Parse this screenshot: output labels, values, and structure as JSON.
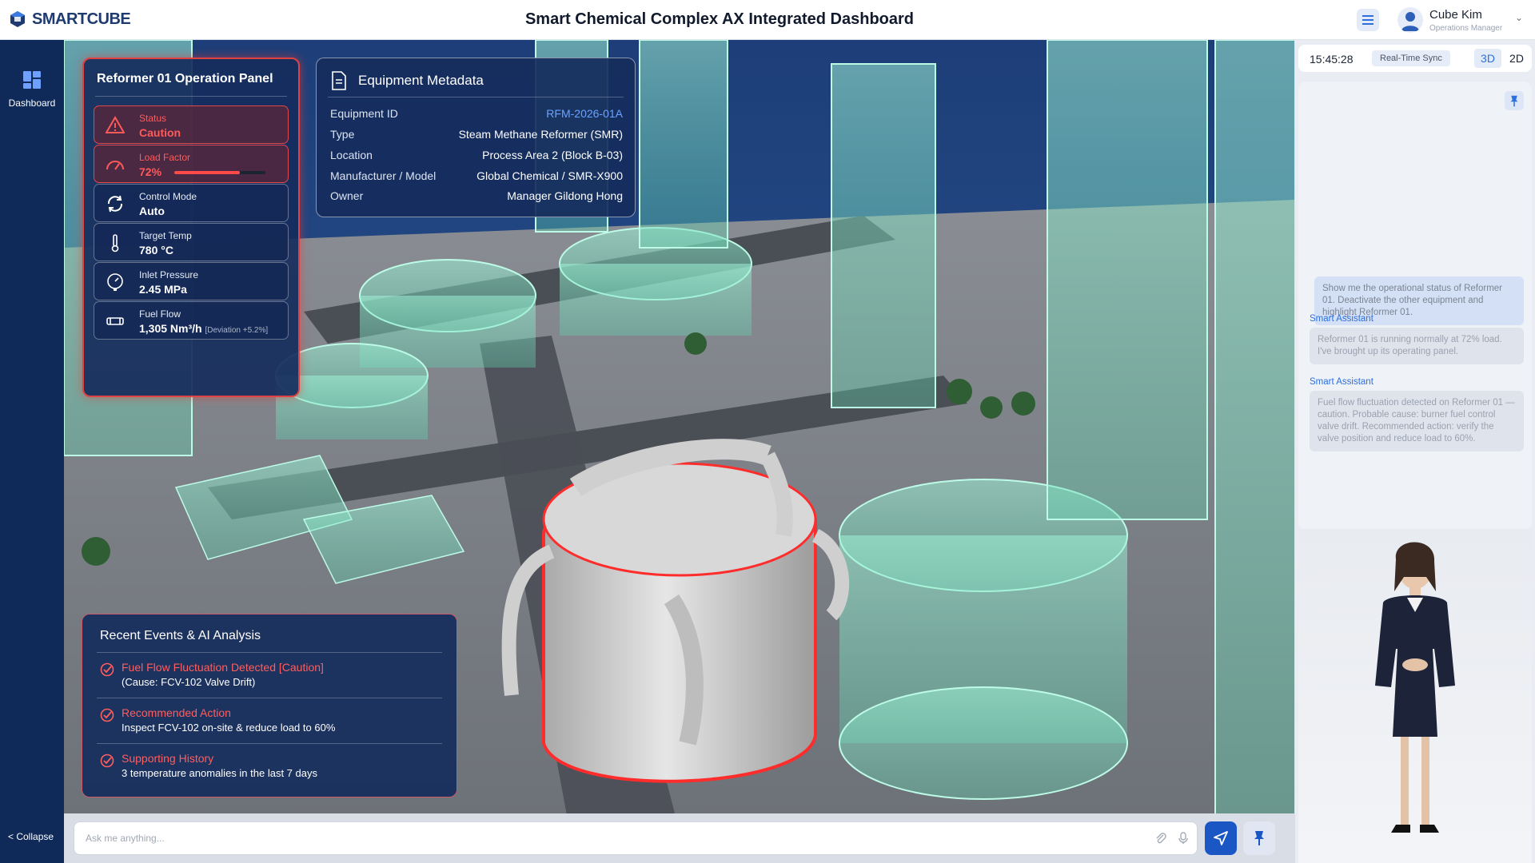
{
  "app": {
    "logo_text": "SMARTCUBE",
    "title": "Smart Chemical Complex AX Integrated Dashboard",
    "user_name": "Cube Kim",
    "user_role": "Operations Manager"
  },
  "nav": {
    "items": [
      {
        "label": "Dashboard",
        "icon": "dashboard-grid-icon"
      }
    ],
    "collapse_label": "< Collapse"
  },
  "operation_panel": {
    "title": "Reformer 01 Operation Panel",
    "cards": [
      {
        "label": "Status",
        "value": "Caution",
        "icon": "warning-icon",
        "alert": true
      },
      {
        "label": "Load Factor",
        "value": "72%",
        "icon": "gauge-icon",
        "alert": true,
        "progress": 0.72
      },
      {
        "label": "Control Mode",
        "value": "Auto",
        "icon": "refresh-icon"
      },
      {
        "label": "Target Temp",
        "value": "780 °C",
        "icon": "thermometer-icon"
      },
      {
        "label": "Inlet Pressure",
        "value": "2.45 MPa",
        "icon": "pressure-gauge-icon"
      },
      {
        "label": "Fuel Flow",
        "value": "1,305 Nm³/h",
        "sub": "[Deviation +5.2%]",
        "icon": "flow-pipe-icon"
      }
    ]
  },
  "metadata": {
    "title": "Equipment Metadata",
    "rows": [
      {
        "key": "Equipment ID",
        "value": "RFM-2026-01A"
      },
      {
        "key": "Type",
        "value": "Steam Methane Reformer (SMR)"
      },
      {
        "key": "Location",
        "value": "Process Area 2 (Block B-03)"
      },
      {
        "key": "Manufacturer / Model",
        "value": "Global Chemical / SMR-X900"
      },
      {
        "key": "Owner",
        "value": "Manager Gildong Hong"
      }
    ]
  },
  "events": {
    "title": "Recent Events & AI Analysis",
    "items": [
      {
        "head": "Fuel Flow Fluctuation Detected [Caution]",
        "body": "(Cause: FCV-102 Valve Drift)"
      },
      {
        "head": "Recommended Action",
        "body": "Inspect FCV-102 on-site & reduce load to 60%"
      },
      {
        "head": "Supporting History",
        "body": "3 temperature anomalies in the last 7 days"
      }
    ]
  },
  "chat_input": {
    "placeholder": "Ask me anything..."
  },
  "right_panel": {
    "clock": "15:45:28",
    "sync_label": "Real-Time Sync",
    "view_3d": "3D",
    "view_2d": "2D",
    "messages": {
      "user": "Show me the operational status of Reformer 01. Deactivate the other equipment and highlight Reformer 01.",
      "assistant_name": "Smart Assistant",
      "assistant_1": "Reformer 01 is running normally at 72% load. I've brought up its operating panel.",
      "assistant_2": "Fuel flow fluctuation detected on Reformer 01 — caution. Probable cause: burner fuel control valve drift. Recommended action: verify the valve position and reduce load to 60%."
    }
  },
  "colors": {
    "nav_bg": "#0f2a58",
    "panel_bg": "#162d5c",
    "alert_red": "#e04141",
    "accent_blue": "#2d6fe0",
    "hologram_green": "#7fe9c6"
  }
}
